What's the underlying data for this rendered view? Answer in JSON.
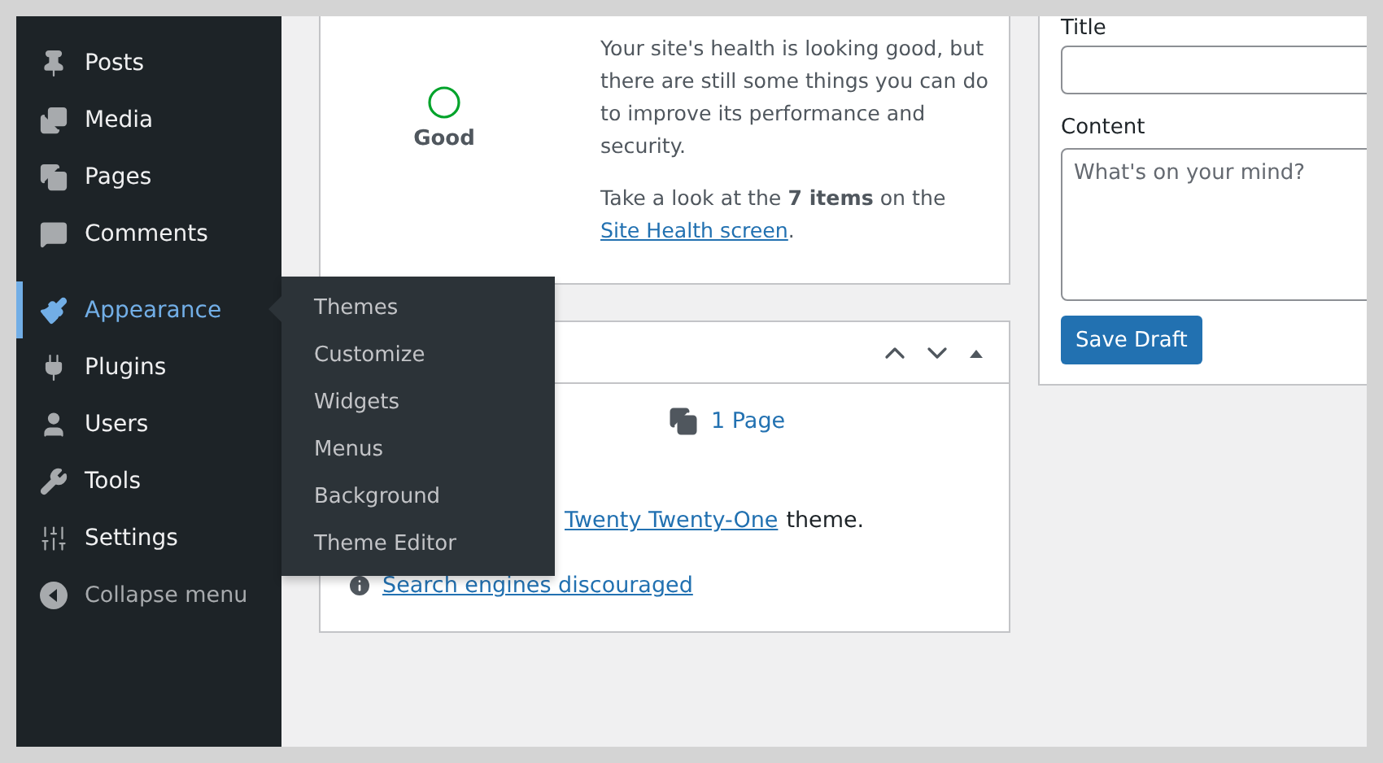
{
  "sidebar": {
    "items": [
      {
        "label": "Posts",
        "selected": false
      },
      {
        "label": "Media",
        "selected": false
      },
      {
        "label": "Pages",
        "selected": false
      },
      {
        "label": "Comments",
        "selected": false
      },
      {
        "label": "Appearance",
        "selected": true
      },
      {
        "label": "Plugins",
        "selected": false
      },
      {
        "label": "Users",
        "selected": false
      },
      {
        "label": "Tools",
        "selected": false
      },
      {
        "label": "Settings",
        "selected": false
      }
    ],
    "collapse": "Collapse menu",
    "flyout": [
      "Themes",
      "Customize",
      "Widgets",
      "Menus",
      "Background",
      "Theme Editor"
    ]
  },
  "health": {
    "status": "Good",
    "message": "Your site's health is looking good, but there are still some things you can do to improve its performance and security.",
    "prompt": "Take a look at the **7 items** on the",
    "link": "Site Health screen",
    "after": "."
  },
  "glance": {
    "pages": "1 Page",
    "theme_link": "Twenty Twenty-One",
    "theme_after": "theme.",
    "search_link": "Search engines discouraged"
  },
  "draft": {
    "title_label": "Title",
    "content_label": "Content",
    "content_placeholder": "What's on your mind?",
    "button": "Save Draft"
  }
}
